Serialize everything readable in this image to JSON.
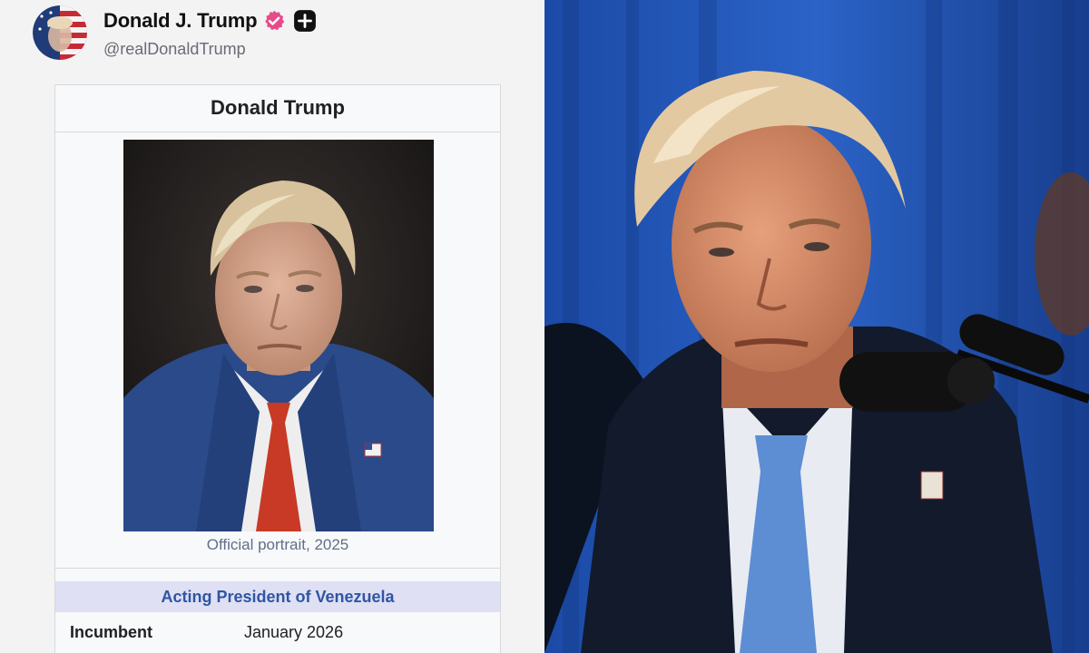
{
  "post": {
    "display_name": "Donald J. Trump",
    "handle": "@realDonaldTrump",
    "verified_icon": "verified-badge-icon",
    "plus_icon": "plus-badge-icon",
    "avatar_icon": "profile-avatar"
  },
  "infobox": {
    "title": "Donald Trump",
    "caption": "Official portrait, 2025",
    "office": "Acting President of Venezuela",
    "rows": [
      {
        "label": "Incumbent",
        "value": "January 2026"
      }
    ]
  },
  "colors": {
    "verified_badge": "#e84a8a",
    "office_header_bg": "#dfe0f4",
    "office_header_text": "#2f55a4",
    "caption_text": "#5f6f86",
    "photo_backdrop": "#1a4aa8"
  }
}
